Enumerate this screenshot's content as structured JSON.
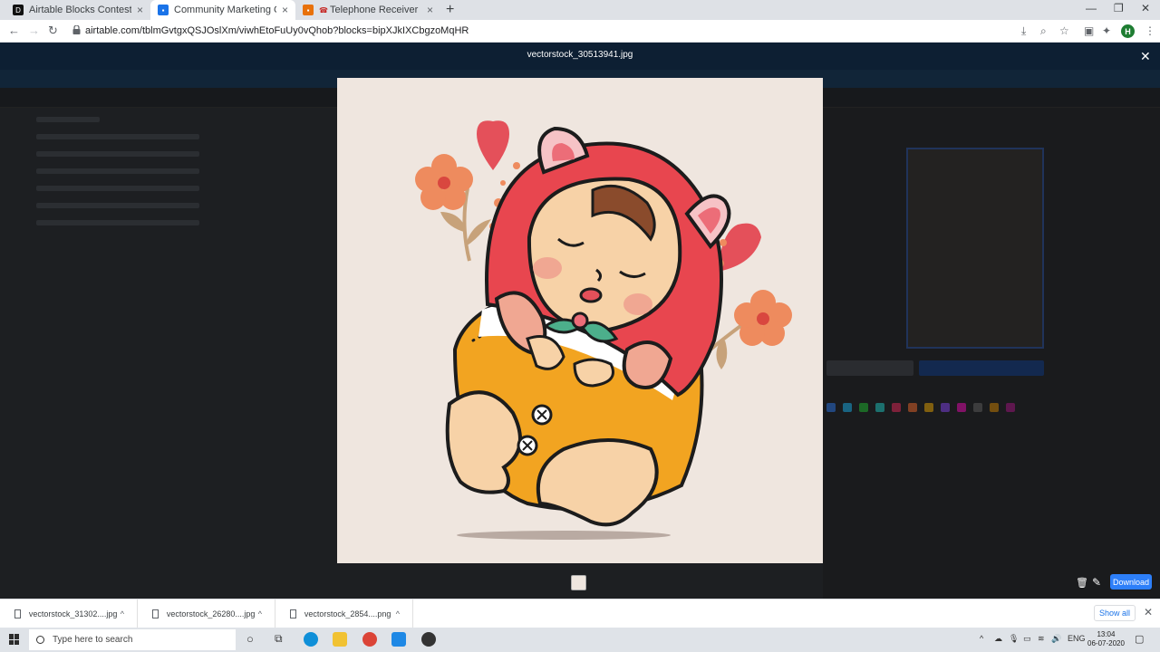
{
  "browser": {
    "tabs": [
      {
        "label": "Airtable Blocks Contest: Introduc",
        "favicon_color": "#111111",
        "active": false
      },
      {
        "label": "Community Marketing Calendar:",
        "favicon_color": "#1a73e8",
        "active": true
      },
      {
        "label": "Telephone Receiver Emoji",
        "favicon_color": "#e8710a",
        "active": false
      }
    ],
    "url": "airtable.com/tblmGvtgxQSJOslXm/viwhEtoFuUy0vQhob?blocks=bipXJkIXCbgzoMqHR",
    "profile_initial": "H"
  },
  "lightbox": {
    "filename": "vectorstock_30513941.jpg",
    "download_label": "Download"
  },
  "downloads": {
    "items": [
      {
        "name": "vectorstock_31302....jpg"
      },
      {
        "name": "vectorstock_26280....jpg"
      },
      {
        "name": "vectorstock_2854....png"
      }
    ],
    "show_all_label": "Show all"
  },
  "taskbar": {
    "search_placeholder": "Type here to search",
    "language": "ENG",
    "time": "13:04",
    "date": "06-07-2020"
  },
  "colors": {
    "accent_blue": "#2d7ff9",
    "preview_bg": "#efe6df",
    "hood_red": "#e8464f",
    "body_yellow": "#f2a421"
  }
}
